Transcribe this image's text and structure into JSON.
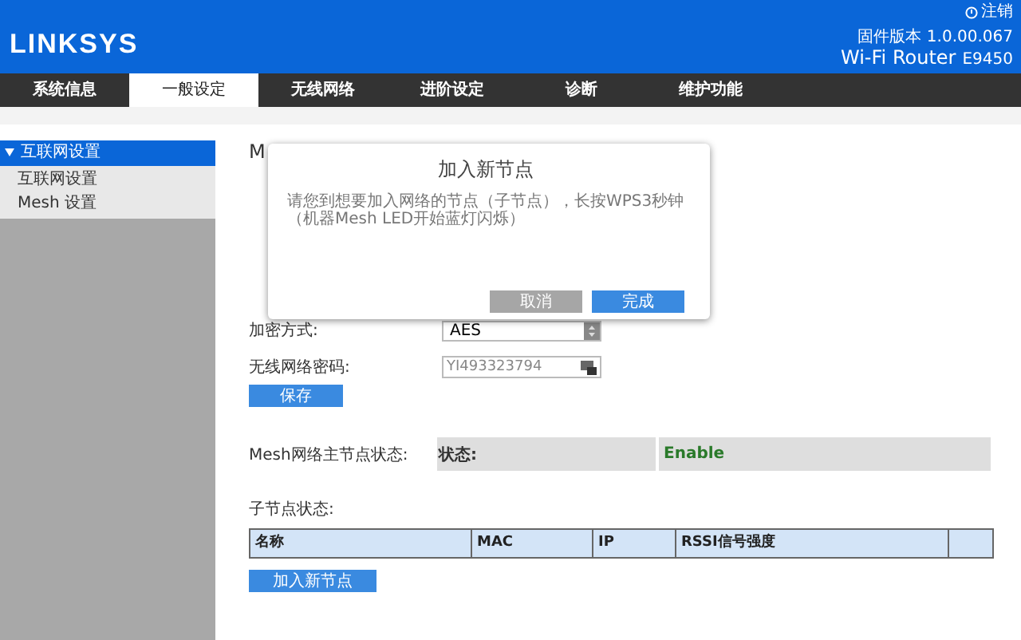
{
  "header": {
    "logo": "LINKSYS",
    "logout": "注销",
    "firmware": "固件版本 1.0.00.067",
    "product": "Wi-Fi Router",
    "model": "E9450"
  },
  "tabs": [
    {
      "label": "系统信息",
      "selected": false
    },
    {
      "label": "一般设定",
      "selected": true
    },
    {
      "label": "无线网络",
      "selected": false
    },
    {
      "label": "进阶设定",
      "selected": false
    },
    {
      "label": "诊断",
      "selected": false
    },
    {
      "label": "维护功能",
      "selected": false
    }
  ],
  "sidebar": {
    "group": {
      "label": "互联网设置",
      "expanded": true
    },
    "items": [
      "互联网设置",
      "Mesh 设置"
    ]
  },
  "form": {
    "heading_fragment": "M",
    "fields": [
      {
        "kind": "select",
        "label": "加密方式:",
        "value": "AES"
      },
      {
        "kind": "password",
        "label": "无线网络密码:",
        "value": "YI493323794"
      }
    ],
    "save": "保存"
  },
  "mesh_status": {
    "label": "Mesh网络主节点状态:",
    "key": "状态:",
    "value": "Enable"
  },
  "child_nodes": {
    "label": "子节点状态:",
    "columns": [
      "名称",
      "MAC",
      "IP",
      "RSSI信号强度",
      ""
    ],
    "add_button": "加入新节点"
  },
  "dialog": {
    "title": "加入新节点",
    "message": "请您到想要加入网络的节点（子节点），长按WPS3秒钟（机器Mesh LED开始蓝灯闪烁）",
    "buttons": [
      {
        "kind": "secondary",
        "label": "取消"
      },
      {
        "kind": "primary",
        "label": "完成"
      }
    ]
  }
}
